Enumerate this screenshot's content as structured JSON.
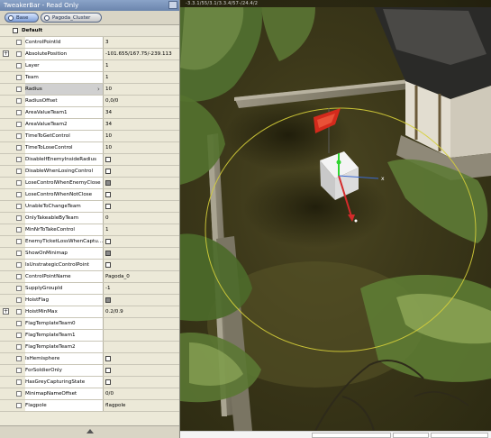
{
  "window": {
    "title": "TweakerBar - Read Only"
  },
  "tabs": [
    {
      "label": "Base"
    },
    {
      "label": "Pagoda_Cluster"
    }
  ],
  "group": {
    "label": "Default"
  },
  "properties": [
    {
      "name": "ControlPointId",
      "value": "3"
    },
    {
      "name": "AbsolutePosition",
      "value": "-101.655/167.75/-239.113",
      "expander": "+"
    },
    {
      "name": "Layer",
      "value": "1"
    },
    {
      "name": "Team",
      "value": "1"
    },
    {
      "name": "Radius",
      "value": "10",
      "selected": true
    },
    {
      "name": "RadiusOffset",
      "value": "0,0/0"
    },
    {
      "name": "AreaValueTeam1",
      "value": "34"
    },
    {
      "name": "AreaValueTeam2",
      "value": "34"
    },
    {
      "name": "TimeToGetControl",
      "value": "10"
    },
    {
      "name": "TimeToLoseControl",
      "value": "10"
    },
    {
      "name": "DisableIfEnemyInsideRadius",
      "checkbox": "off"
    },
    {
      "name": "DisableWhenLosingControl",
      "checkbox": "off"
    },
    {
      "name": "LoseControlWhenEnemyClose",
      "checkbox": "on"
    },
    {
      "name": "LoseControlWhenNotClose",
      "checkbox": "off"
    },
    {
      "name": "UnableToChangeTeam",
      "checkbox": "off"
    },
    {
      "name": "OnlyTakeableByTeam",
      "value": "0"
    },
    {
      "name": "MinNrToTakeControl",
      "value": "1"
    },
    {
      "name": "EnemyTicketLossWhenCaptu...",
      "checkbox": "off"
    },
    {
      "name": "ShowOnMinimap",
      "checkbox": "on"
    },
    {
      "name": "IsUnstrategicControlPoint",
      "checkbox": "off"
    },
    {
      "name": "ControlPointName",
      "value": "Pagoda_0"
    },
    {
      "name": "SupplyGroupId",
      "value": "-1"
    },
    {
      "name": "HoistFlag",
      "checkbox": "on"
    },
    {
      "name": "HoistMinMax",
      "value": "0.2/0.9",
      "expander": "+"
    },
    {
      "name": "FlagTemplateTeam0",
      "value": ""
    },
    {
      "name": "FlagTemplateTeam1",
      "value": ""
    },
    {
      "name": "FlagTemplateTeam2",
      "value": ""
    },
    {
      "name": "IsHemisphere",
      "checkbox": "off"
    },
    {
      "name": "ForSoldierOnly",
      "checkbox": "off"
    },
    {
      "name": "HasGreyCapturingState",
      "checkbox": "off"
    },
    {
      "name": "MinimapNameOffset",
      "value": "0/0"
    },
    {
      "name": "Flagpole",
      "value": "flagpole"
    }
  ],
  "viewport": {
    "coords": "-3.3.1/55/3.1/3.3.4/57-/24.4/2"
  },
  "colors": {
    "radius_circle": "#d6cf3a",
    "flag": "#d42a1c",
    "gizmo_up": "#2fd42f",
    "gizmo_forward": "#d42a2a",
    "gizmo_side": "#3a6ad4",
    "selected_row": "#d0d0d0"
  }
}
